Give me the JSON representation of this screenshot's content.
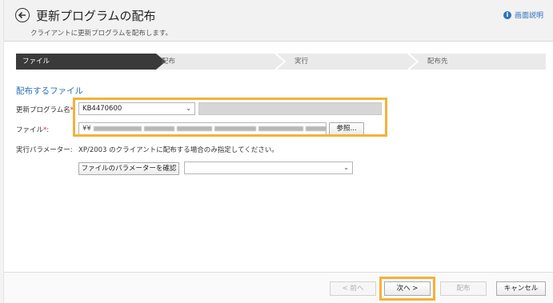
{
  "header": {
    "title": "更新プログラムの配布",
    "subtitle": "クライアントに更新プログラムを配布します。",
    "help_label": "画面説明",
    "help_icon": "info-icon"
  },
  "wizard": {
    "steps": [
      {
        "label": "ファイル",
        "active": true
      },
      {
        "label": "配布",
        "active": false
      },
      {
        "label": "実行",
        "active": false
      },
      {
        "label": "配布先",
        "active": false
      }
    ]
  },
  "form": {
    "section_title": "配布するファイル",
    "update_program_label": "更新プログラム名",
    "update_program_value": "KB4470600",
    "required_mark": "*",
    "label_suffix": ":",
    "file_label": "ファイル",
    "file_path_prefix": "¥¥",
    "browse_label": "参照...",
    "exec_params_label": "実行パラメーター:",
    "exec_params_hint": "XP/2003 のクライアントに配布する場合のみ指定してください。",
    "check_params_label": "ファイルのパラメーターを確認",
    "params_select_value": ""
  },
  "footer": {
    "prev_label": "< 前へ",
    "next_label": "次へ >",
    "distribute_label": "配布",
    "cancel_label": "キャンセル"
  },
  "colors": {
    "accent": "#2d72b8",
    "highlight": "#f3b23a",
    "required": "#e02020",
    "active_step": "#3a3a3a"
  }
}
